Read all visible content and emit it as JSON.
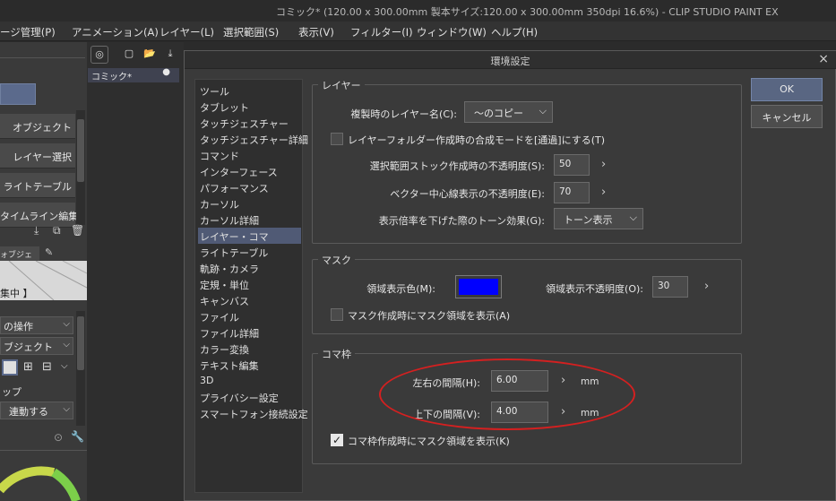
{
  "window": {
    "title": "コミック* (120.00 x 300.00mm 製本サイズ:120.00 x 300.00mm 350dpi 16.6%)  - CLIP STUDIO PAINT EX"
  },
  "menubar": {
    "items": [
      "ージ管理(P)",
      "アニメーション(A)",
      "レイヤー(L)",
      "選択範囲(S)",
      "表示(V)",
      "フィルター(I)",
      "ウィンドウ(W)",
      "ヘルプ(H)"
    ]
  },
  "left_panel": {
    "tabs": [
      "オブジェクト",
      "レイヤー選択",
      "ライトテーブル",
      "タイムライン編集"
    ],
    "subtab": "ォブジェクト]",
    "header_text": "集中 】",
    "selects": [
      "の操作",
      "ブジェクト"
    ],
    "section_label": "ップ",
    "link_select": "連動する"
  },
  "doc_tab": {
    "label": "コミック*",
    "dot": "●"
  },
  "dialog": {
    "title": "環境設定",
    "close": "×",
    "categories": [
      "ツール",
      "タブレット",
      "タッチジェスチャー",
      "タッチジェスチャー詳細",
      "コマンド",
      "インターフェース",
      "パフォーマンス",
      "カーソル",
      "カーソル詳細",
      "レイヤー・コマ",
      "ライトテーブル",
      "軌跡・カメラ",
      "定規・単位",
      "キャンバス",
      "ファイル",
      "ファイル詳細",
      "カラー変換",
      "テキスト編集",
      "3D",
      "プライバシー設定",
      "スマートフォン接続設定"
    ],
    "selected_category": 9,
    "ok": "OK",
    "cancel": "キャンセル",
    "layer_group": {
      "title": "レイヤー",
      "dup_name_label": "複製時のレイヤー名(C):",
      "dup_name_value": "〜のコピー",
      "folder_mode_label": "レイヤーフォルダー作成時の合成モードを[通過]にする(T)",
      "folder_mode_checked": false,
      "stock_opacity_label": "選択範囲ストック作成時の不透明度(S):",
      "stock_opacity_value": "50",
      "vector_opacity_label": "ベクター中心線表示の不透明度(E):",
      "vector_opacity_value": "70",
      "tone_effect_label": "表示倍率を下げた際のトーン効果(G):",
      "tone_effect_value": "トーン表示"
    },
    "mask_group": {
      "title": "マスク",
      "color_label": "領域表示色(M):",
      "color": "#0000ff",
      "opacity_label": "領域表示不透明度(O):",
      "opacity_value": "30",
      "show_label": "マスク作成時にマスク領域を表示(A)",
      "show_checked": false
    },
    "frame_group": {
      "title": "コマ枠",
      "h_label": "左右の間隔(H):",
      "h_value": "6.00",
      "v_label": "上下の間隔(V):",
      "v_value": "4.00",
      "unit": "mm",
      "show_label": "コマ枠作成時にマスク領域を表示(K)",
      "show_checked": true
    }
  },
  "colors": {
    "accent": "#596682",
    "annotation": "#d42020",
    "mask_color": "#0000ff"
  }
}
